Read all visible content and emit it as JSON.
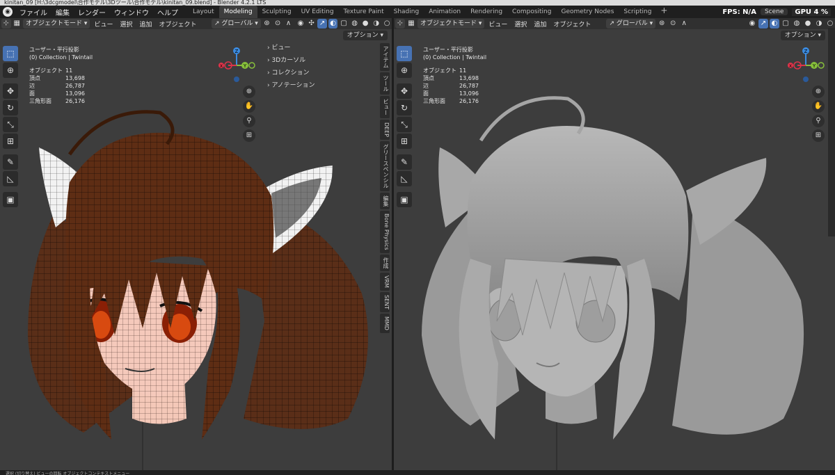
{
  "window": {
    "title": "kinitan_09 [H:\\3dcgmodel\\合作モデル\\3Dツール\\合作モデル\\kinitan_09.blend] - Blender 4.2.1 LTS"
  },
  "menus": [
    "ファイル",
    "編集",
    "レンダー",
    "ウィンドウ",
    "ヘルプ"
  ],
  "workspaces": [
    "Layout",
    "Modeling",
    "Sculpting",
    "UV Editing",
    "Texture Paint",
    "Shading",
    "Animation",
    "Rendering",
    "Compositing",
    "Geometry Nodes",
    "Scripting"
  ],
  "active_workspace": "Modeling",
  "topright": {
    "fps": "FPS: N/A",
    "scene": "Scene",
    "gpu": "GPU 4 %"
  },
  "left_header": {
    "mode": "オブジェクトモード",
    "menus": [
      "ビュー",
      "選択",
      "追加",
      "オブジェクト"
    ],
    "orientation": "グローバル",
    "options": "オプション"
  },
  "right_header": {
    "mode": "オブジェクトモード",
    "menus": [
      "ビュー",
      "選択",
      "追加",
      "オブジェクト"
    ],
    "orientation": "グローバル",
    "options": "オプション"
  },
  "overlay_left": {
    "view_name": "ユーザー・平行投影",
    "collection": "(0) Collection | Twintail",
    "stats": [
      [
        "オブジェクト",
        "11"
      ],
      [
        "頂点",
        "13,698"
      ],
      [
        "辺",
        "26,787"
      ],
      [
        "面",
        "13,096"
      ],
      [
        "三角形面",
        "26,176"
      ]
    ]
  },
  "overlay_right": {
    "view_name": "ユーザー・平行投影",
    "collection": "(0) Collection | Twintail",
    "stats": [
      [
        "オブジェクト",
        "11"
      ],
      [
        "頂点",
        "13,698"
      ],
      [
        "辺",
        "26,787"
      ],
      [
        "面",
        "13,096"
      ],
      [
        "三角形面",
        "26,176"
      ]
    ]
  },
  "npanel": {
    "items": [
      "ビュー",
      "3Dカーソル",
      "コレクション",
      "アノテーション"
    ]
  },
  "sidebar_tabs": [
    "アイテム",
    "ツール",
    "ビュー",
    "DEEP",
    "グリースペンシル",
    "編集",
    "Bone Physics",
    "作成",
    "VRM",
    "SENT",
    "MMD"
  ],
  "gizmo": {
    "x": "X",
    "y": "Y",
    "z": "Z"
  },
  "statusbar": {
    "text": "選択 (切り替え)   ビューの回転   オブジェクトコンテキストメニュー"
  },
  "colors": {
    "accent": "#4772b3",
    "viewport_bg": "#3d3d3d",
    "header_bg": "#303030",
    "x_axis": "#e0334a",
    "y_axis": "#87c03b",
    "z_axis": "#3b8be0"
  }
}
